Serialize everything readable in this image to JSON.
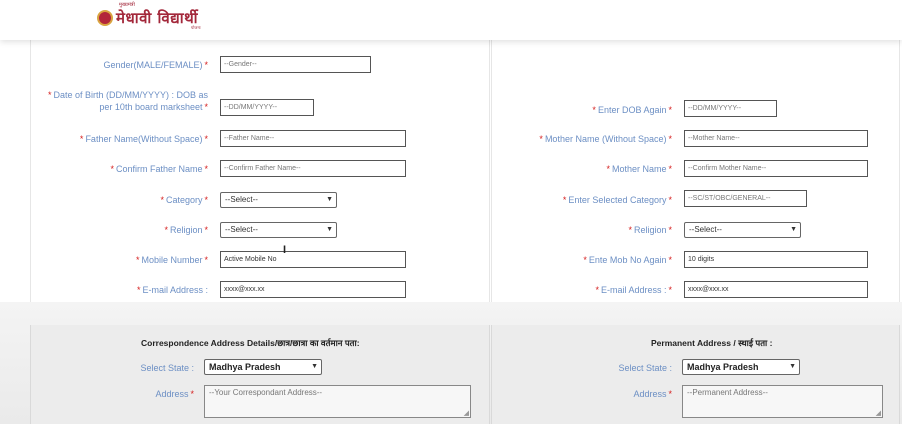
{
  "header": {
    "logo_text": "मेधावी विद्यार्थी",
    "logo_top": "मुख्यमंत्री",
    "logo_bottom": "योजना"
  },
  "left": {
    "gender": {
      "label": "Gender(MALE/FEMALE)",
      "value": "--Gender--"
    },
    "dob": {
      "label": "Date of Birth (DD/MM/YYYY) : DOB as per 10th board marksheet",
      "placeholder": "--DD/MM/YYYY--"
    },
    "father": {
      "label": "Father Name(Without Space)",
      "placeholder": "--Father Name--"
    },
    "confirm_father": {
      "label": "Confirm Father Name",
      "placeholder": "--Confirm Father Name--"
    },
    "category": {
      "label": "Category",
      "value": "--Select--"
    },
    "religion": {
      "label": "Religion",
      "value": "--Select--"
    },
    "mobile": {
      "label": "Mobile Number",
      "placeholder": "Active Mobile No"
    },
    "email": {
      "label": "E-mail Address :",
      "placeholder": "xxxx@xxx.xx"
    }
  },
  "right": {
    "dob_again": {
      "label": "Enter DOB Again",
      "placeholder": "--DD/MM/YYYY--"
    },
    "mother": {
      "label": "Mother Name (Without Space)",
      "placeholder": "--Mother Name--"
    },
    "confirm_mother": {
      "label": "Mother Name",
      "placeholder": "--Confirm Mother Name--"
    },
    "selected_category": {
      "label": "Enter Selected Category",
      "placeholder": "--SC/ST/OBC/GENERAL--"
    },
    "religion": {
      "label": "Religion",
      "value": "--Select--"
    },
    "mobile_again": {
      "label": "Ente Mob No Again",
      "placeholder": "10 digits"
    },
    "email": {
      "label": "E-mail Address :",
      "placeholder": "xxxx@xxx.xx"
    }
  },
  "correspondence": {
    "title": "Correspondence Address Details/छात्र/छात्रा का वर्तमान पता:",
    "state_label": "Select State :",
    "state_value": "Madhya Pradesh",
    "address_label": "Address",
    "address_placeholder": "--Your Correspondant Address--"
  },
  "permanent": {
    "title": "Permanent Address / स्थाई पता :",
    "state_label": "Select State :",
    "state_value": "Madhya Pradesh",
    "address_label": "Address",
    "address_placeholder": "--Permanent Address--"
  },
  "icons": {
    "chevron": "chevron-down-icon",
    "emblem": "emblem-icon",
    "cursor": "text-cursor-icon"
  }
}
